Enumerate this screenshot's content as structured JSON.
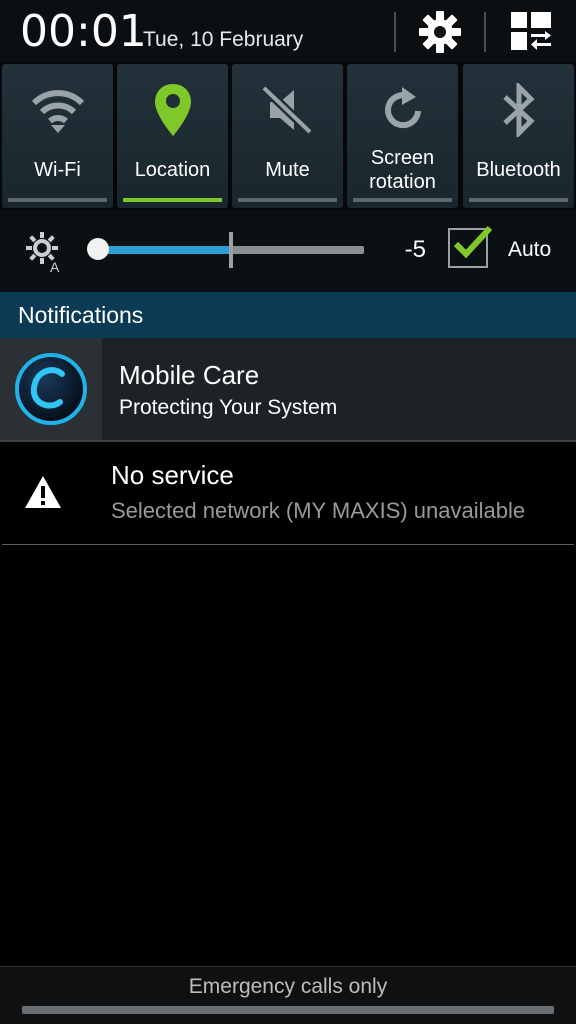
{
  "header": {
    "time": "00:01",
    "date": "Tue, 10 February",
    "settings_icon": "gear-icon",
    "grid_icon": "grid-switch-icon"
  },
  "toggles": [
    {
      "label": "Wi-Fi",
      "icon": "wifi-icon",
      "active": false
    },
    {
      "label": "Location",
      "icon": "location-pin-icon",
      "active": true
    },
    {
      "label": "Mute",
      "icon": "mute-icon",
      "active": false
    },
    {
      "label": "Screen\nrotation",
      "label_line1": "Screen",
      "label_line2": "rotation",
      "icon": "rotation-icon",
      "active": false
    },
    {
      "label": "Bluetooth",
      "icon": "bluetooth-icon",
      "active": false
    }
  ],
  "brightness": {
    "icon": "auto-brightness-icon",
    "value_label": "-5",
    "level_fraction": 0.0,
    "auto_label": "Auto",
    "auto_checked": true
  },
  "notifications": {
    "header": "Notifications",
    "items": [
      {
        "title": "Mobile Care",
        "subtitle": "Protecting Your System",
        "icon": "mobile-care-app-icon"
      },
      {
        "title": "No service",
        "subtitle": "Selected network (MY MAXIS) unavailable",
        "icon": "warning-icon"
      }
    ]
  },
  "footer": {
    "text": "Emergency calls only"
  },
  "colors": {
    "accent_green": "#7ec82a",
    "slider_blue": "#2aa0d6",
    "notif_header_bg": "#0b3a54"
  }
}
